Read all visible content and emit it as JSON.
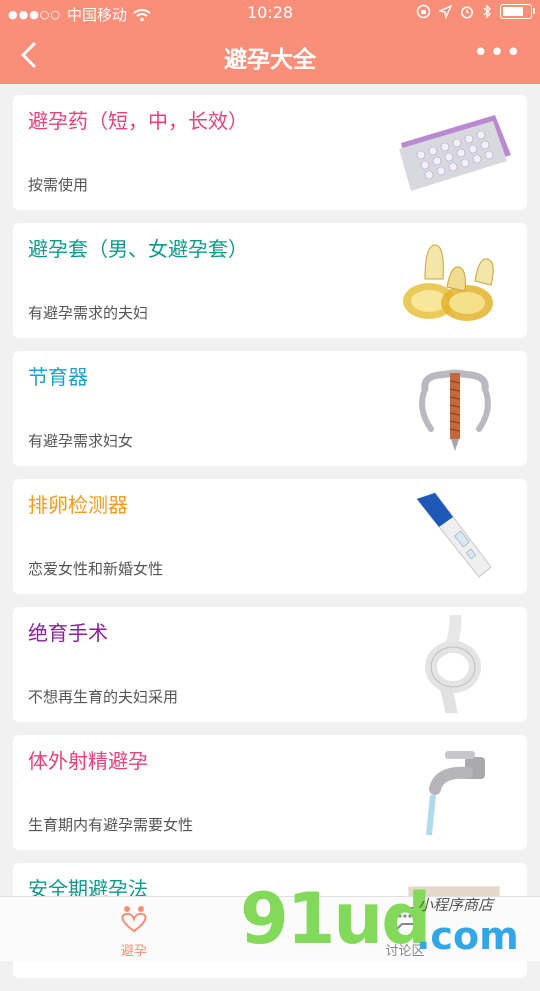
{
  "status": {
    "carrier": "中国移动",
    "time": "10:28"
  },
  "nav": {
    "title": "避孕大全",
    "more": "•••"
  },
  "items": [
    {
      "title": "避孕药（短，中，长效）",
      "subtitle": "按需使用",
      "color": "#e8417c",
      "image": "pill-pack"
    },
    {
      "title": "避孕套（男、女避孕套）",
      "subtitle": "有避孕需求的夫妇",
      "color": "#0d9a8c",
      "image": "condom"
    },
    {
      "title": "节育器",
      "subtitle": "有避孕需求妇女",
      "color": "#1e9fd6",
      "image": "iud"
    },
    {
      "title": "排卵检测器",
      "subtitle": "恋爱女性和新婚女性",
      "color": "#f49b1e",
      "image": "ovulation-test"
    },
    {
      "title": "绝育手术",
      "subtitle": "不想再生育的夫妇采用",
      "color": "#8b1f9f",
      "image": "rope-knot"
    },
    {
      "title": "体外射精避孕",
      "subtitle": "生育期内有避孕需要女性",
      "color": "#e8417c",
      "image": "faucet"
    },
    {
      "title": "安全期避孕法",
      "subtitle": "",
      "color": "#0d9a8c",
      "image": "calendar"
    }
  ],
  "tabs": [
    {
      "label": "避孕",
      "color": "#f98e79",
      "icon": "heart-people-icon"
    },
    {
      "label": "讨论区",
      "color": "#888888",
      "icon": "chat-icon"
    }
  ],
  "watermark": {
    "brand": "91ud",
    "domain": ".com",
    "handwritten": "小程序商店"
  }
}
